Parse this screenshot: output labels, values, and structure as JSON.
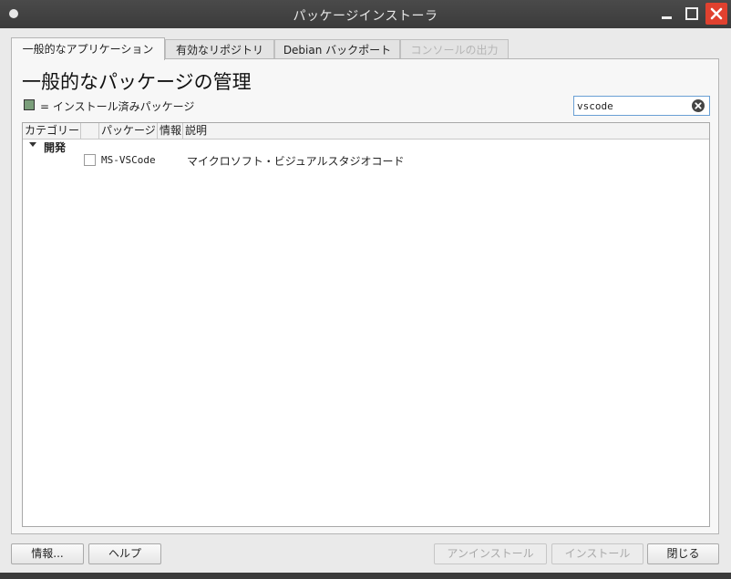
{
  "window": {
    "title": "パッケージインストーラ"
  },
  "tabs": [
    {
      "label": "一般的なアプリケーション",
      "state": "active"
    },
    {
      "label": "有効なリポジトリ",
      "state": "normal"
    },
    {
      "label": "Debian バックポート",
      "state": "normal"
    },
    {
      "label": "コンソールの出力",
      "state": "disabled"
    }
  ],
  "main": {
    "heading": "一般的なパッケージの管理",
    "legend": {
      "text": "= インストール済みパッケージ",
      "swatch_color": "#7a9e7a"
    },
    "search": {
      "value": "vscode"
    }
  },
  "table": {
    "columns": [
      "カテゴリー",
      "",
      "パッケージ",
      "情報",
      "説明"
    ],
    "categories": [
      {
        "name": "開発",
        "expanded": true,
        "packages": [
          {
            "installed": false,
            "name": "MS-VSCode",
            "description": "マイクロソフト・ビジュアルスタジオコード"
          }
        ]
      }
    ]
  },
  "buttons": {
    "about": "情報...",
    "help": "ヘルプ",
    "uninstall": "アンインストール",
    "install": "インストール",
    "close": "閉じる"
  },
  "colors": {
    "close_button": "#e0412f",
    "titlebar": "#3b3b3b",
    "search_focus": "#6a9fd4"
  }
}
